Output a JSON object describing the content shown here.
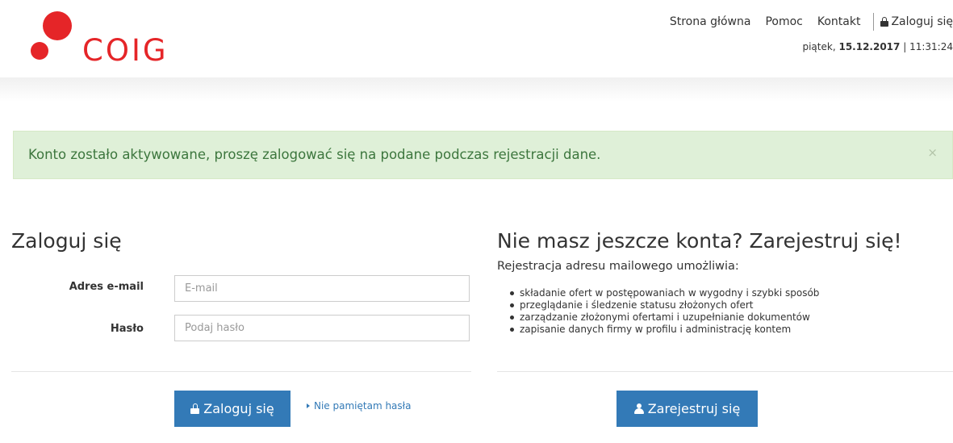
{
  "brand": {
    "logo_text": "COIG",
    "color": "#e52528"
  },
  "topnav": {
    "home": "Strona główna",
    "help": "Pomoc",
    "contact": "Kontakt",
    "login": "Zaloguj się"
  },
  "datebar": {
    "day": "piątek,",
    "date": "15.12.2017",
    "separator": "|",
    "time": "11:31:24"
  },
  "alert": {
    "message": "Konto zostało aktywowane, proszę zalogować się na podane podczas rejestracji dane.",
    "close": "×"
  },
  "login": {
    "title": "Zaloguj się",
    "email_label": "Adres e-mail",
    "email_placeholder": "E-mail",
    "password_label": "Hasło",
    "password_placeholder": "Podaj hasło",
    "submit": "Zaloguj się",
    "forgot": "Nie pamiętam hasła"
  },
  "register": {
    "title": "Nie masz jeszcze konta? Zarejestruj się!",
    "subtitle": "Rejestracja adresu mailowego umożliwia:",
    "benefits": [
      "składanie ofert w postępowaniach w wygodny i szybki sposób",
      "przeglądanie i śledzenie statusu złożonych ofert",
      "zarządzanie złożonymi ofertami i uzupełnianie dokumentów",
      "zapisanie danych firmy w profilu i administrację kontem"
    ],
    "submit": "Zarejestruj się"
  },
  "colors": {
    "primary_button": "#337ab7",
    "alert_background": "#dff0d8",
    "alert_text": "#3c763d"
  }
}
